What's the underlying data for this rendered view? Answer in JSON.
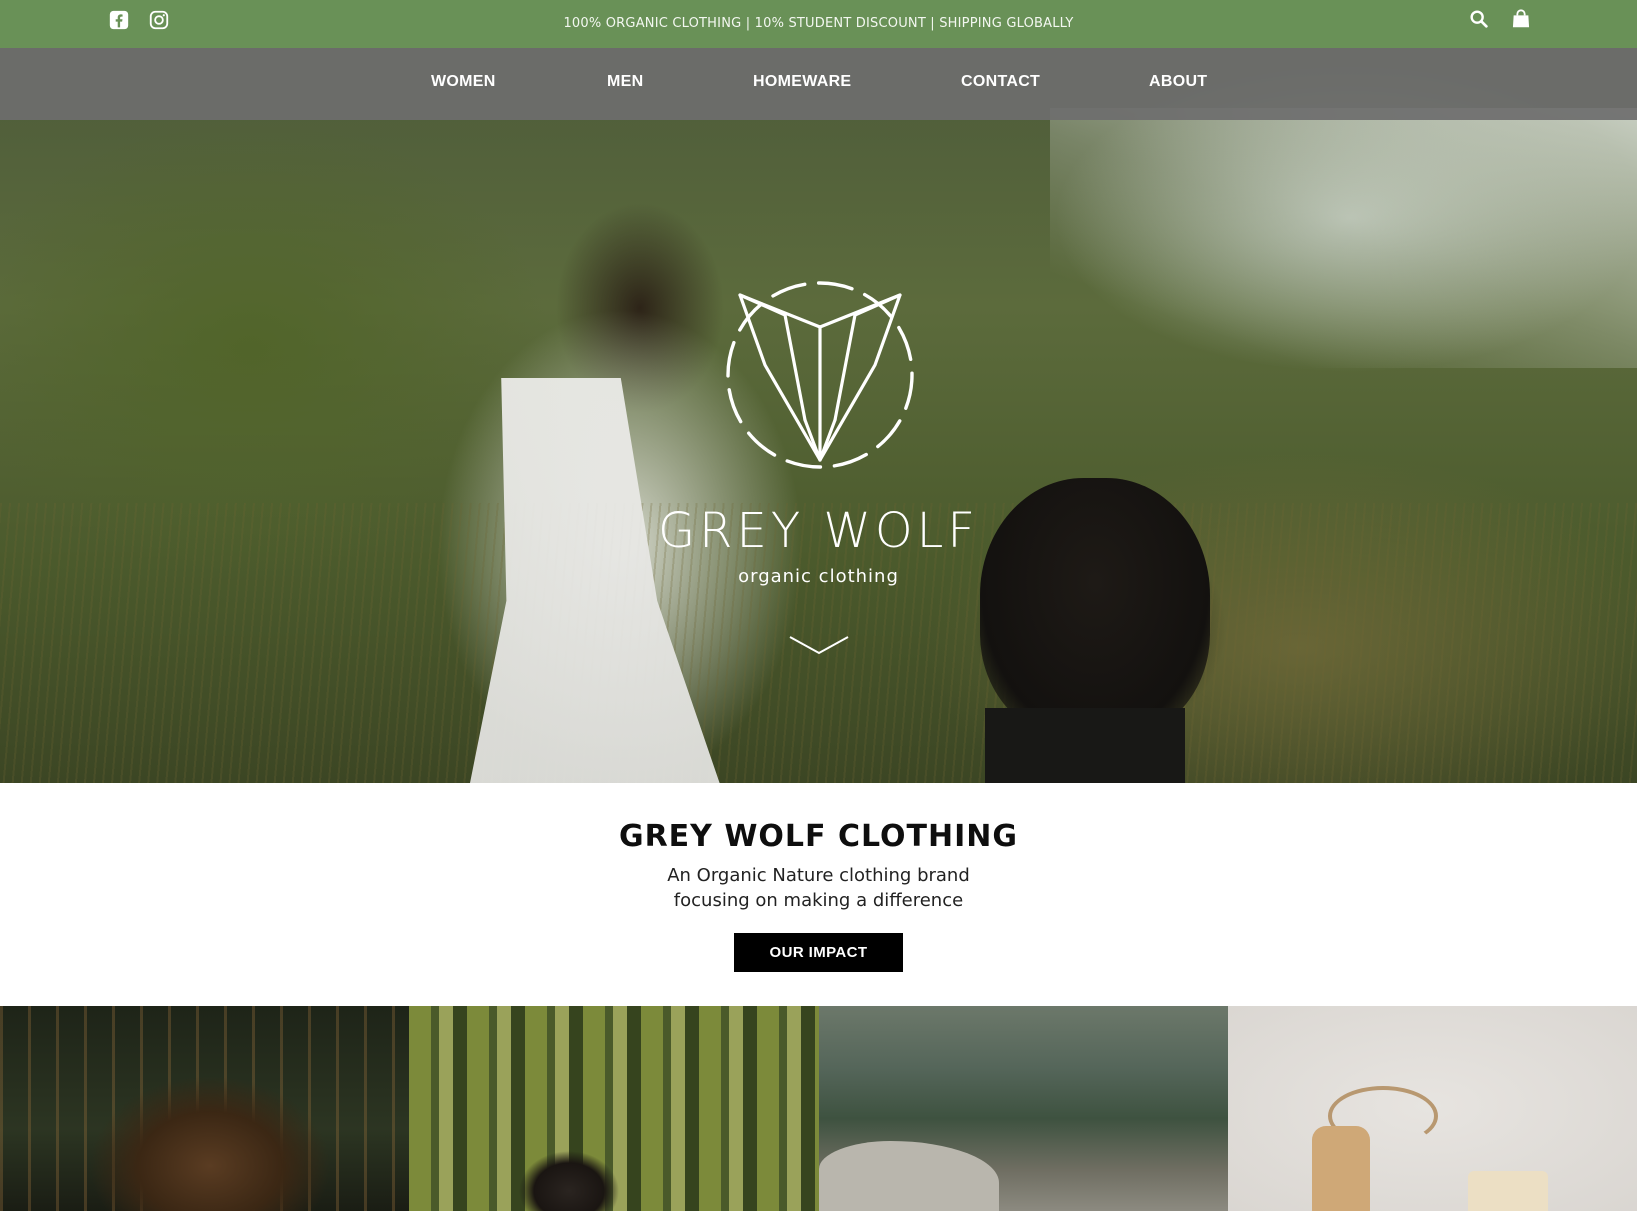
{
  "topbar": {
    "promo": "100% ORGANIC CLOTHING | 10% STUDENT DISCOUNT | SHIPPING GLOBALLY",
    "social_icons": [
      "facebook-icon",
      "instagram-icon"
    ],
    "right_icons": [
      "search-icon",
      "shopping-bag-icon"
    ],
    "bg_color": "#699157"
  },
  "nav": {
    "items": [
      {
        "label": "WOMEN"
      },
      {
        "label": "MEN"
      },
      {
        "label": "HOMEWARE"
      },
      {
        "label": "CONTACT"
      },
      {
        "label": "ABOUT"
      }
    ]
  },
  "hero": {
    "brand": "GREY WOLF",
    "tagline": "organic clothing",
    "logo_icon": "wolf-logo-icon",
    "scroll_icon": "chevron-down-icon"
  },
  "intro": {
    "heading": "GREY WOLF CLOTHING",
    "line1": "An Organic Nature clothing brand",
    "line2": "focusing on making a difference",
    "cta": "OUR IMPACT"
  },
  "tiles": [
    {
      "subject": "woman-in-jungle"
    },
    {
      "subject": "man-in-bamboo"
    },
    {
      "subject": "lake-landscape"
    },
    {
      "subject": "homeware-brush-soap"
    }
  ]
}
